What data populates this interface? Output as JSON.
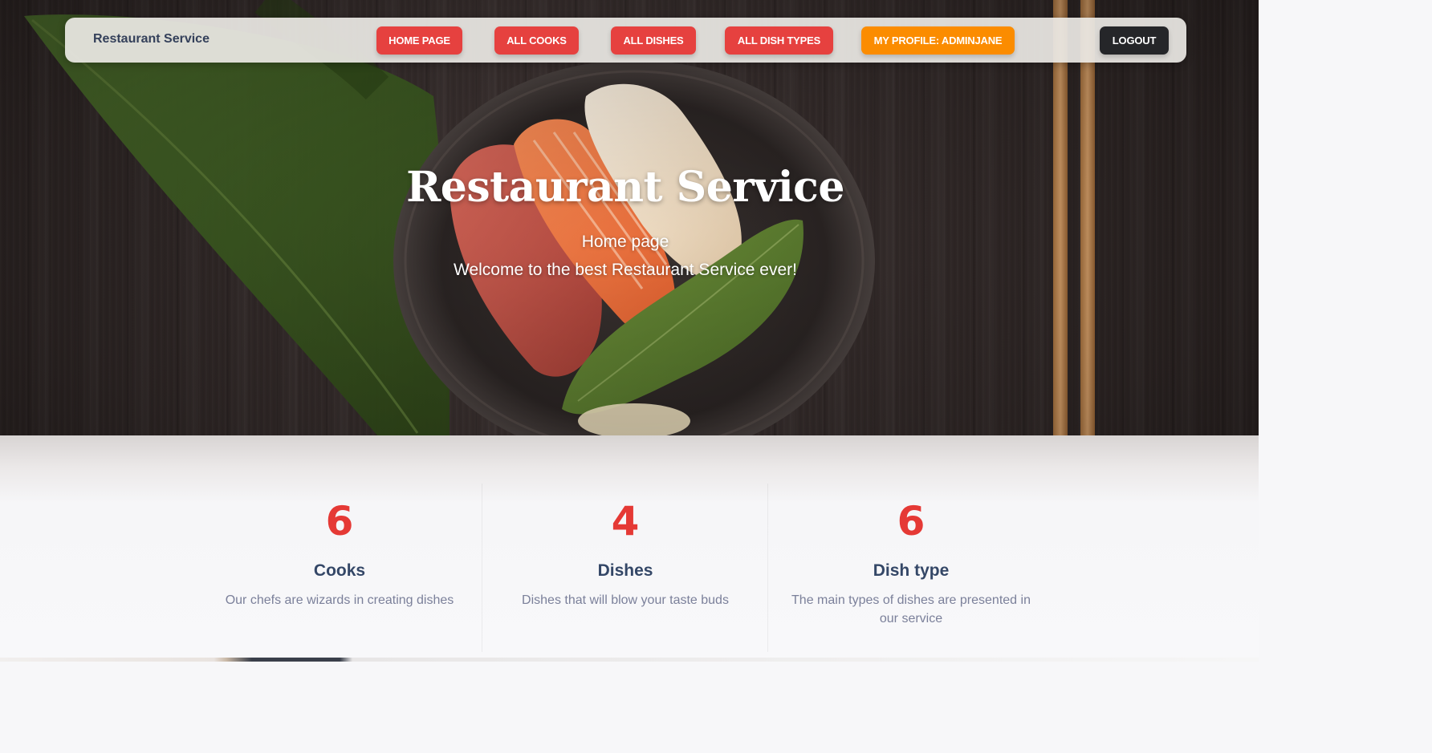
{
  "navbar": {
    "brand": "Restaurant Service",
    "buttons": {
      "home": "HOME PAGE",
      "cooks": "ALL COOKS",
      "dishes": "ALL DISHES",
      "dish_types": "ALL DISH TYPES",
      "profile": "MY PROFILE: ADMINJANE",
      "logout": "LOGOUT"
    }
  },
  "hero": {
    "title": "Restaurant Service",
    "subtitle": "Home page",
    "welcome": "Welcome to the best Restaurant Service ever!"
  },
  "stats": [
    {
      "number": "6",
      "label": "Cooks",
      "description": "Our chefs are wizards in creating dishes"
    },
    {
      "number": "4",
      "label": "Dishes",
      "description": "Dishes that will blow your taste buds"
    },
    {
      "number": "6",
      "label": "Dish type",
      "description": "The main types of dishes are presented in our service"
    }
  ],
  "colors": {
    "accent_red": "#e6413f",
    "profile_orange": "#fb8c00",
    "logout_dark": "#252629",
    "stat_number_red": "#e53935",
    "heading_navy": "#344767",
    "muted_text": "#7b809a"
  },
  "icons": [
    "sushi-hero-image"
  ]
}
